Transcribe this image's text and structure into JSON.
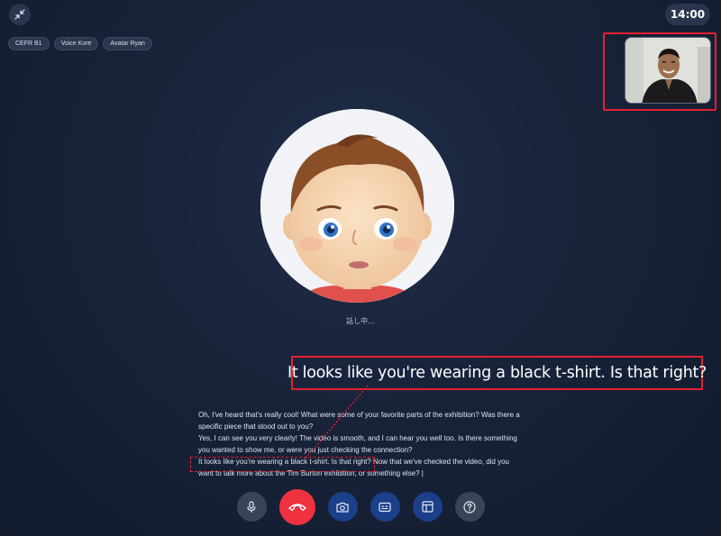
{
  "header": {
    "timer": "14:00",
    "collapse_icon": "collapse-arrows-icon"
  },
  "tags": [
    "CEFR B1",
    "Voice Kore",
    "Avatar Ryan"
  ],
  "avatar": {
    "status": "話し中..."
  },
  "caption": "It looks like you're wearing a black t-shirt. Is that right?",
  "transcript": [
    "Oh, I've heard that's really cool! What were some of your favorite parts of the exhibition? Was there a specific piece that stood out to you?",
    "Yes, I can see you very clearly! The video is smooth, and I can hear you well too. Is there something you wanted to show me, or were you just checking the connection?",
    "It looks like you're wearing a black t-shirt. Is that right? Now that we've checked the video, did you want to talk more about the Tim Burton exhibition, or something else?"
  ],
  "controls": [
    {
      "name": "mic-button",
      "icon": "microphone-icon"
    },
    {
      "name": "end-call-button",
      "icon": "phone-hangup-icon",
      "color": "#f0313f"
    },
    {
      "name": "camera-button",
      "icon": "camera-icon"
    },
    {
      "name": "captions-button",
      "icon": "captions-icon"
    },
    {
      "name": "layout-button",
      "icon": "layout-icon"
    },
    {
      "name": "help-button",
      "icon": "help-icon"
    }
  ],
  "colors": {
    "background": "#18233a",
    "highlight": "#e5202e",
    "end_call": "#f0313f",
    "active_button": "#1c3f8a"
  }
}
